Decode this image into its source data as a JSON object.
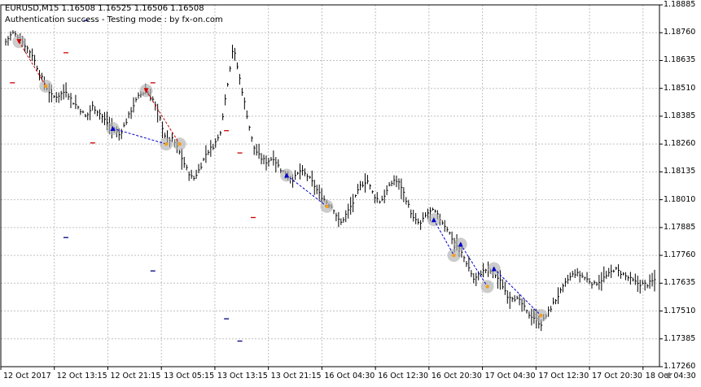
{
  "header": {
    "symbol_line": "EURUSD,M15  1.16508 1.16525 1.16506 1.16508",
    "status_line": "Authentication success - Testing mode : by fx-on.com"
  },
  "colors": {
    "background": "#ffffff",
    "grid": "#c0c0c0",
    "bars": "#000000",
    "buy_arrow": "#0000cc",
    "sell_arrow": "#cc0000",
    "exit_marker": "#f0a020",
    "highlight_circle": "#b0b0b0",
    "level_red": "#cc0000",
    "level_blue": "#000080"
  },
  "chart_data": {
    "type": "ohlc",
    "symbol": "EURUSD",
    "timeframe": "M15",
    "last_ohlc": {
      "open": 1.16508,
      "high": 1.16525,
      "low": 1.16506,
      "close": 1.16508
    },
    "ylim": [
      1.1726,
      1.18885
    ],
    "y_ticks": [
      "1.18885",
      "1.18760",
      "1.18635",
      "1.18510",
      "1.18385",
      "1.18260",
      "1.18135",
      "1.18010",
      "1.17885",
      "1.17760",
      "1.17635",
      "1.17510",
      "1.17385",
      "1.17260"
    ],
    "x_tick_labels": [
      "12 Oct 2017",
      "12 Oct 13:15",
      "12 Oct 21:15",
      "13 Oct 05:15",
      "13 Oct 13:15",
      "13 Oct 21:15",
      "16 Oct 04:30",
      "16 Oct 12:30",
      "16 Oct 20:30",
      "17 Oct 04:30",
      "17 Oct 12:30",
      "17 Oct 20:30",
      "18 Oct 04:30"
    ],
    "x_tick_positions": [
      0,
      8,
      16,
      24,
      32,
      40,
      48,
      56,
      64,
      72,
      80,
      88,
      96
    ],
    "close_path": [
      [
        0,
        1.1872
      ],
      [
        1,
        1.1876
      ],
      [
        2,
        1.1874
      ],
      [
        3,
        1.187
      ],
      [
        4,
        1.1866
      ],
      [
        5,
        1.1858
      ],
      [
        6,
        1.1852
      ],
      [
        7,
        1.1847
      ],
      [
        8,
        1.1848
      ],
      [
        9,
        1.185
      ],
      [
        10,
        1.1845
      ],
      [
        11,
        1.1842
      ],
      [
        12,
        1.1838
      ],
      [
        13,
        1.1843
      ],
      [
        14,
        1.184
      ],
      [
        15,
        1.1836
      ],
      [
        16,
        1.1833
      ],
      [
        17,
        1.183
      ],
      [
        18,
        1.1836
      ],
      [
        19,
        1.1843
      ],
      [
        20,
        1.1848
      ],
      [
        21,
        1.185
      ],
      [
        22,
        1.1846
      ],
      [
        23,
        1.1838
      ],
      [
        24,
        1.1828
      ],
      [
        25,
        1.1828
      ],
      [
        26,
        1.1822
      ],
      [
        27,
        1.1815
      ],
      [
        28,
        1.181
      ],
      [
        29,
        1.1815
      ],
      [
        30,
        1.1822
      ],
      [
        31,
        1.1825
      ],
      [
        32,
        1.183
      ],
      [
        33,
        1.185
      ],
      [
        34,
        1.187
      ],
      [
        35,
        1.1855
      ],
      [
        36,
        1.184
      ],
      [
        37,
        1.1825
      ],
      [
        38,
        1.182
      ],
      [
        39,
        1.1818
      ],
      [
        40,
        1.182
      ],
      [
        41,
        1.1815
      ],
      [
        42,
        1.1812
      ],
      [
        43,
        1.181
      ],
      [
        44,
        1.1814
      ],
      [
        45,
        1.1812
      ],
      [
        46,
        1.1808
      ],
      [
        47,
        1.1803
      ],
      [
        48,
        1.18
      ],
      [
        49,
        1.1797
      ],
      [
        50,
        1.179
      ],
      [
        51,
        1.1795
      ],
      [
        52,
        1.18
      ],
      [
        53,
        1.1807
      ],
      [
        54,
        1.181
      ],
      [
        55,
        1.1803
      ],
      [
        56,
        1.18
      ],
      [
        57,
        1.1805
      ],
      [
        58,
        1.181
      ],
      [
        59,
        1.1808
      ],
      [
        60,
        1.18
      ],
      [
        61,
        1.1792
      ],
      [
        62,
        1.179
      ],
      [
        63,
        1.1795
      ],
      [
        64,
        1.1796
      ],
      [
        65,
        1.1792
      ],
      [
        66,
        1.1788
      ],
      [
        67,
        1.1782
      ],
      [
        68,
        1.1778
      ],
      [
        69,
        1.1772
      ],
      [
        70,
        1.1765
      ],
      [
        71,
        1.1768
      ],
      [
        72,
        1.177
      ],
      [
        73,
        1.1768
      ],
      [
        74,
        1.1764
      ],
      [
        75,
        1.1758
      ],
      [
        76,
        1.1757
      ],
      [
        77,
        1.1755
      ],
      [
        78,
        1.175
      ],
      [
        79,
        1.1748
      ],
      [
        80,
        1.1745
      ],
      [
        81,
        1.175
      ],
      [
        82,
        1.1755
      ],
      [
        83,
        1.176
      ],
      [
        84,
        1.1765
      ],
      [
        85,
        1.1768
      ],
      [
        86,
        1.1767
      ],
      [
        87,
        1.1765
      ],
      [
        88,
        1.1763
      ],
      [
        89,
        1.1765
      ],
      [
        90,
        1.1767
      ],
      [
        91,
        1.177
      ],
      [
        92,
        1.1768
      ],
      [
        93,
        1.1766
      ],
      [
        94,
        1.1764
      ],
      [
        95,
        1.1763
      ],
      [
        96,
        1.1763
      ],
      [
        97,
        1.1765
      ]
    ],
    "trades": [
      {
        "entry": [
          2,
          1.1872
        ],
        "exit": [
          6,
          1.1852
        ],
        "direction": "sell"
      },
      {
        "entry": [
          16,
          1.1833
        ],
        "exit": [
          24,
          1.1826
        ],
        "direction": "buy"
      },
      {
        "entry": [
          21,
          1.185
        ],
        "exit": [
          26,
          1.1826
        ],
        "direction": "sell"
      },
      {
        "entry": [
          42,
          1.1812
        ],
        "exit": [
          48,
          1.1798
        ],
        "direction": "buy"
      },
      {
        "entry": [
          64,
          1.1792
        ],
        "exit": [
          67,
          1.1776
        ],
        "direction": "buy"
      },
      {
        "entry": [
          68,
          1.1781
        ],
        "exit": [
          72,
          1.1762
        ],
        "direction": "buy"
      },
      {
        "entry": [
          73,
          1.177
        ],
        "exit": [
          80,
          1.1749
        ],
        "direction": "buy"
      }
    ],
    "level_markers": [
      {
        "x": 1,
        "y": 1.18535,
        "color": "red"
      },
      {
        "x": 9,
        "y": 1.1867,
        "color": "red"
      },
      {
        "x": 9,
        "y": 1.1784,
        "color": "blue"
      },
      {
        "x": 12,
        "y": 1.18815,
        "color": "blue"
      },
      {
        "x": 13,
        "y": 1.18265,
        "color": "red"
      },
      {
        "x": 22,
        "y": 1.18535,
        "color": "red"
      },
      {
        "x": 22,
        "y": 1.1769,
        "color": "blue"
      },
      {
        "x": 33,
        "y": 1.1832,
        "color": "red"
      },
      {
        "x": 33,
        "y": 1.17475,
        "color": "blue"
      },
      {
        "x": 35,
        "y": 1.1822,
        "color": "red"
      },
      {
        "x": 35,
        "y": 1.17375,
        "color": "blue"
      },
      {
        "x": 37,
        "y": 1.1793,
        "color": "red"
      }
    ]
  }
}
